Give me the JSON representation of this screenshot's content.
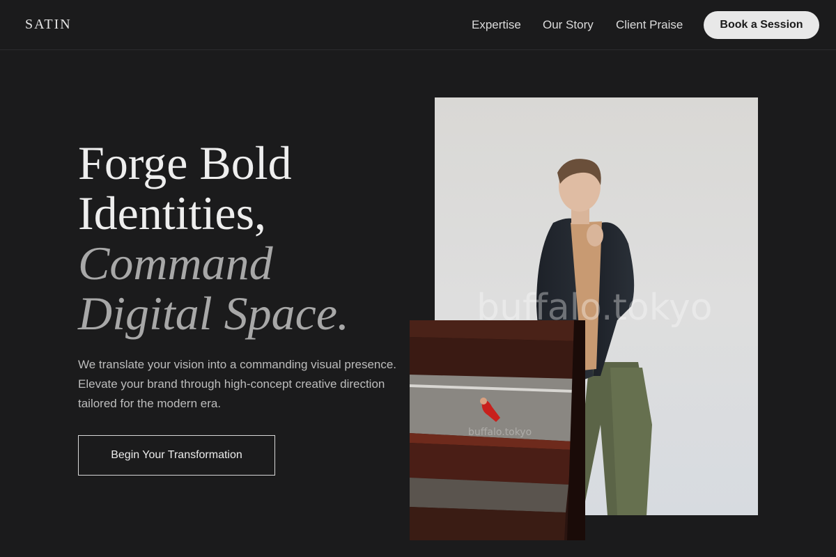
{
  "header": {
    "brand": "SATIN",
    "nav": [
      "Expertise",
      "Our Story",
      "Client Praise"
    ],
    "cta": "Book a Session"
  },
  "hero": {
    "headline_line1": "Forge Bold",
    "headline_line2": "Identities,",
    "headline_line3": "Command",
    "headline_line4": "Digital Space.",
    "lead": "We translate your vision into a commanding visual presence. Elevate your brand through high-concept creative direction tailored for the modern era.",
    "cta": "Begin Your Transformation"
  },
  "images": {
    "main_watermark": "buffalo.tokyo",
    "small_watermark": "buffalo.tokyo"
  },
  "colors": {
    "background": "#1b1b1c",
    "text": "#eeeeee",
    "accent_muted": "#a8a8a8",
    "button_bg": "#e8e8e8"
  }
}
